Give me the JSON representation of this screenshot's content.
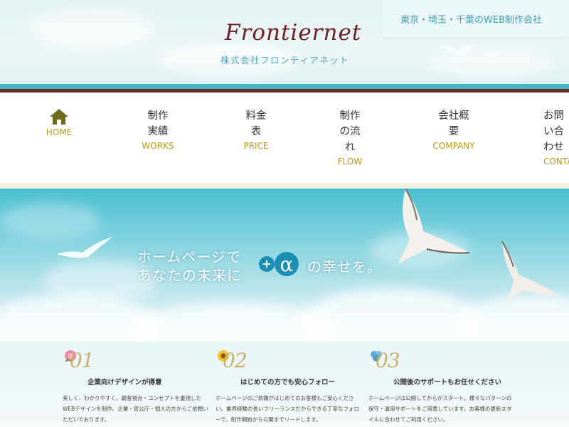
{
  "header": {
    "logo": "Frontiernet",
    "company_name": "株式会社フロンティアネット",
    "tagline": "東京・埼玉・千葉のWEB制作会社"
  },
  "nav": {
    "items": [
      {
        "jp": "",
        "en": "HOME",
        "icon": "home-icon"
      },
      {
        "jp": "制作実績",
        "en": "WORKS"
      },
      {
        "jp": "料金表",
        "en": "PRICE"
      },
      {
        "jp": "制作の流れ",
        "en": "FLOW"
      },
      {
        "jp": "会社概要",
        "en": "COMPANY"
      },
      {
        "jp": "お問い合わせ",
        "en": "CONTACT"
      }
    ]
  },
  "hero": {
    "line1": "ホームページで",
    "line2": "あなたの未来に",
    "badge": "+α",
    "line3": "の幸せを。"
  },
  "features": [
    {
      "num": "01",
      "title": "企業向けデザインが得意",
      "desc": "美しく、わかりやすく。顧客視点・コンセプトを重視したWEBデザインを制作。企業・官公庁・個人の方からご依頼いただいております。",
      "flower_color": "#e98aa0"
    },
    {
      "num": "02",
      "title": "はじめての方でも安心フォロー",
      "desc": "ホームページのご依頼がはじめてのお客様もご安心ください。業界経験の長いフリーランスだからできる丁寧なフォローで、制作開始から公開までリードします。",
      "flower_color": "#f3c233"
    },
    {
      "num": "03",
      "title": "公開後のサポートもお任せください",
      "desc": "ホームページは公開してからがスタート。様々なパターンの保守・運用サポートをご用意しています。お客様の更新スタイルに合わせてご利用ください。",
      "flower_color": "#5fa9d9"
    }
  ],
  "colors": {
    "logo": "#6e1f24",
    "accent_teal": "#3fb8c1",
    "accent_brown": "#6a2a2a",
    "nav_en": "#b99a12"
  }
}
